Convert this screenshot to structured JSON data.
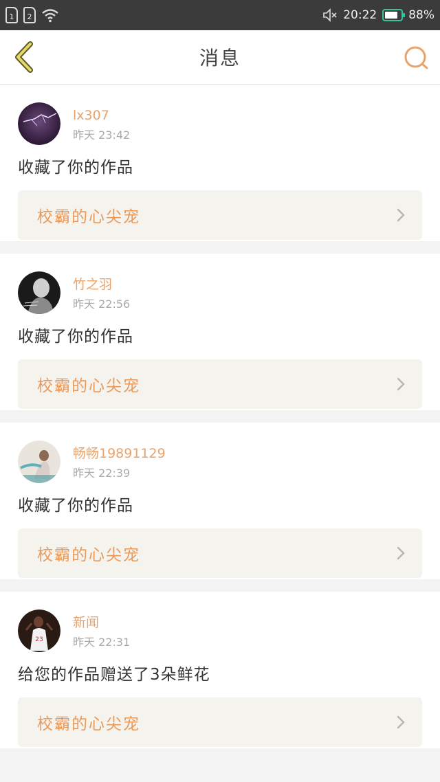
{
  "status_bar": {
    "sim1": "1",
    "sim2": "2",
    "time": "20:22",
    "battery": "88%"
  },
  "nav": {
    "title": "消息",
    "back_icon": "chevron-left-icon",
    "search_icon": "search-icon",
    "accent": "#e9a36a"
  },
  "messages": [
    {
      "user": "lx307",
      "time": "昨天 23:42",
      "action": "收藏了你的作品",
      "work": "校霸的心尖宠"
    },
    {
      "user": "竹之羽",
      "time": "昨天 22:56",
      "action": "收藏了你的作品",
      "work": "校霸的心尖宠"
    },
    {
      "user": "畅畅19891129",
      "time": "昨天 22:39",
      "action": "收藏了你的作品",
      "work": "校霸的心尖宠"
    },
    {
      "user": "新闻",
      "time": "昨天 22:31",
      "action": "给您的作品赠送了3朵鲜花",
      "work": "校霸的心尖宠"
    }
  ]
}
